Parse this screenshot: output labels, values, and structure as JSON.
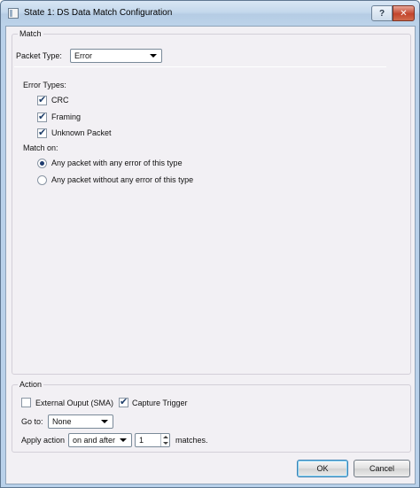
{
  "window": {
    "title": "State 1: DS Data Match Configuration"
  },
  "titlebar": {
    "help_label": "?",
    "close_label": "✕"
  },
  "match": {
    "group_title": "Match",
    "packet_type_label": "Packet Type:",
    "packet_type_value": "Error",
    "error_types_label": "Error Types:",
    "error_types": [
      {
        "label": "CRC",
        "checked": true
      },
      {
        "label": "Framing",
        "checked": true
      },
      {
        "label": "Unknown Packet",
        "checked": true
      }
    ],
    "match_on_label": "Match on:",
    "match_on_options": [
      {
        "label": "Any packet with any error of this type",
        "selected": true
      },
      {
        "label": "Any packet without any error of this type",
        "selected": false
      }
    ]
  },
  "action": {
    "group_title": "Action",
    "external_output_label": "External Ouput (SMA)",
    "external_output_checked": false,
    "capture_trigger_label": "Capture Trigger",
    "capture_trigger_checked": true,
    "goto_label": "Go to:",
    "goto_value": "None",
    "apply_action_label": "Apply action",
    "apply_action_value": "on and after",
    "apply_count": "1",
    "matches_label": "matches."
  },
  "buttons": {
    "ok_label": "OK",
    "cancel_label": "Cancel"
  },
  "check_glyph": "✔"
}
